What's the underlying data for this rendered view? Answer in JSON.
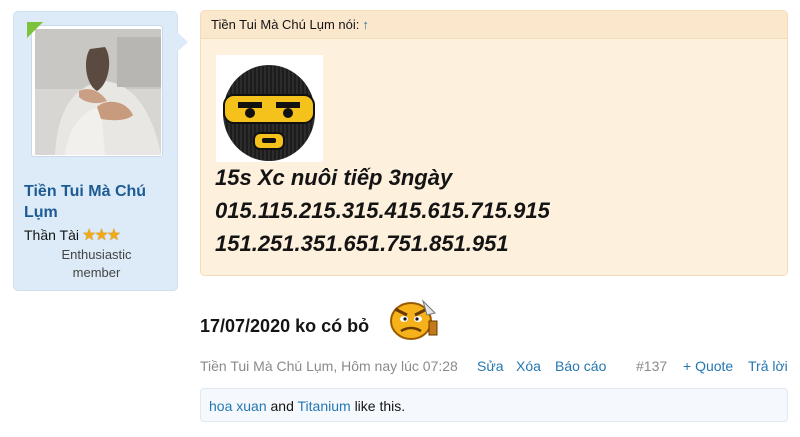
{
  "user": {
    "name": "Tiền Tui Mà Chú Lụm",
    "title": "Thần Tài",
    "stars": "★★★",
    "banner": "Enthusiastic member"
  },
  "quote": {
    "author_line": "Tiền Tui Mà Chú Lụm nói:",
    "up_arrow": "↑",
    "lines": [
      "15s Xc nuôi tiếp 3ngày",
      "015.115.215.315.415.615.715.915",
      "151.251.351.651.751.851.951"
    ]
  },
  "post": {
    "text": "17/07/2020 ko có bỏ"
  },
  "meta": {
    "author_time": "Tiền Tui Mà Chú Lụm, Hôm nay lúc 07:28",
    "edit": "Sửa",
    "delete": "Xóa",
    "report": "Báo cáo",
    "post_number": "#137",
    "quote": "+ Quote",
    "reply": "Trả lời"
  },
  "likes": {
    "user1": "hoa xuan",
    "and": "and",
    "user2": "Titanium",
    "suffix": "like this."
  },
  "colors": {
    "link": "#2577b1",
    "username": "#1d5b95",
    "quote_bg": "#fdf0dd",
    "sidebar_bg": "#dcebf7"
  }
}
